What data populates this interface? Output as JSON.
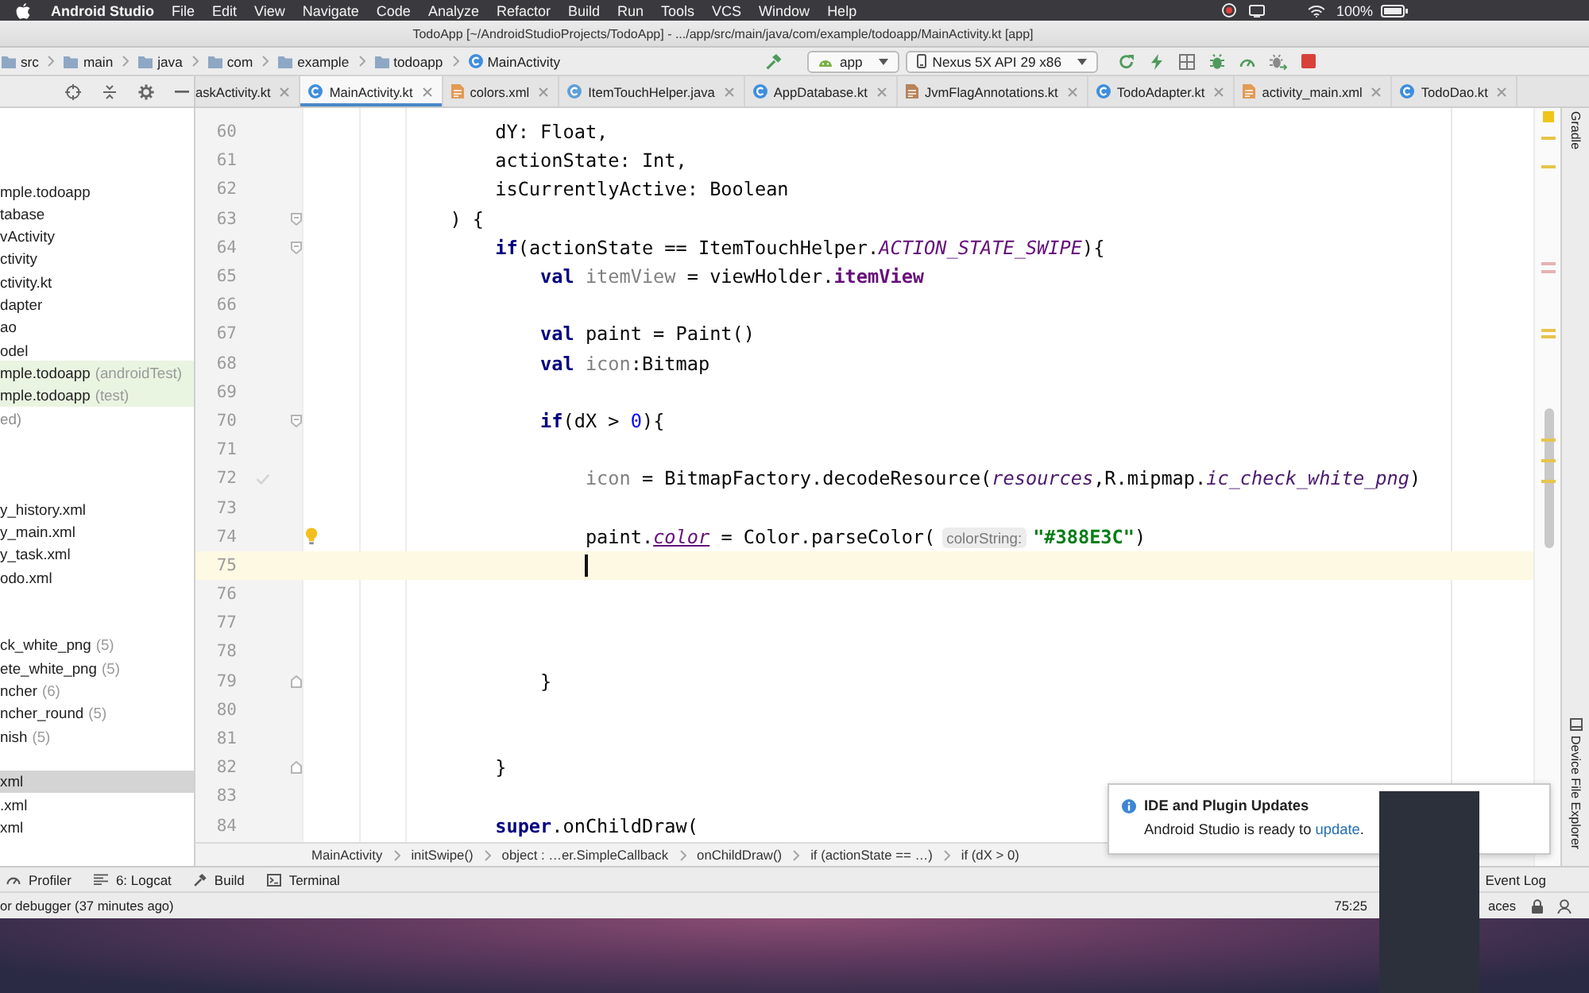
{
  "menu_bar": {
    "app_name": "Android Studio",
    "items": [
      "File",
      "Edit",
      "View",
      "Navigate",
      "Code",
      "Analyze",
      "Refactor",
      "Build",
      "Run",
      "Tools",
      "VCS",
      "Window",
      "Help"
    ],
    "battery": "100%"
  },
  "window": {
    "title": "TodoApp [~/AndroidStudioProjects/TodoApp] - .../app/src/main/java/com/example/todoapp/MainActivity.kt [app]"
  },
  "navigation_bar": {
    "path": [
      {
        "label": "src",
        "kind": "folder"
      },
      {
        "label": "main",
        "kind": "folder"
      },
      {
        "label": "java",
        "kind": "folder"
      },
      {
        "label": "com",
        "kind": "folder"
      },
      {
        "label": "example",
        "kind": "folder"
      },
      {
        "label": "todoapp",
        "kind": "folder"
      },
      {
        "label": "MainActivity",
        "kind": "class"
      }
    ],
    "run_config": "app",
    "device": "Nexus 5X API 29 x86"
  },
  "editor_tabs": [
    {
      "label": "askActivity.kt",
      "kind": "clipped",
      "selected": false
    },
    {
      "label": "MainActivity.kt",
      "kind": "kotlin-class",
      "selected": true
    },
    {
      "label": "colors.xml",
      "kind": "xml",
      "selected": false
    },
    {
      "label": "ItemTouchHelper.java",
      "kind": "java-class",
      "selected": false
    },
    {
      "label": "AppDatabase.kt",
      "kind": "kotlin-class",
      "selected": false
    },
    {
      "label": "JvmFlagAnnotations.kt",
      "kind": "kotlin-file",
      "selected": false
    },
    {
      "label": "TodoAdapter.kt",
      "kind": "kotlin-class",
      "selected": false
    },
    {
      "label": "activity_main.xml",
      "kind": "xml",
      "selected": false
    },
    {
      "label": "TodoDao.kt",
      "kind": "kotlin-class",
      "selected": false
    }
  ],
  "project_tree": [
    {
      "kind": "cut-off",
      "selected": false
    },
    {
      "kind": "cut-off",
      "selected": false
    },
    {
      "kind": "cut-off",
      "selected": false
    },
    {
      "label": "mple.todoapp",
      "kind": "node",
      "selected": false
    },
    {
      "label": "tabase",
      "kind": "node",
      "selected": false
    },
    {
      "label": "vActivity",
      "kind": "node",
      "selected": false
    },
    {
      "label": "ctivity",
      "kind": "node",
      "selected": false
    },
    {
      "label": "ctivity.kt",
      "kind": "node",
      "selected": false
    },
    {
      "label": "dapter",
      "kind": "node",
      "selected": false
    },
    {
      "label": "ao",
      "kind": "node",
      "selected": false
    },
    {
      "label": "odel",
      "kind": "node",
      "selected": false
    },
    {
      "label": "mple.todoapp",
      "hint": "(androidTest)",
      "kind": "test-root",
      "selected": false
    },
    {
      "label": "mple.todoapp",
      "hint": "(test)",
      "kind": "test-root",
      "selected": false
    },
    {
      "label": "ed)",
      "kind": "generated",
      "selected": false
    },
    {
      "kind": "cut-off",
      "selected": false
    },
    {
      "kind": "cut-off",
      "selected": false
    },
    {
      "kind": "cut-off",
      "selected": false
    },
    {
      "label": "y_history.xml",
      "kind": "node",
      "selected": false
    },
    {
      "label": "y_main.xml",
      "kind": "node",
      "selected": false
    },
    {
      "label": "y_task.xml",
      "kind": "node",
      "selected": false
    },
    {
      "label": "odo.xml",
      "kind": "node",
      "selected": false
    },
    {
      "kind": "cut-off",
      "selected": false
    },
    {
      "kind": "cut-off",
      "selected": false
    },
    {
      "label": "ck_white_png",
      "hint": "(5)",
      "kind": "node",
      "selected": false
    },
    {
      "label": "ete_white_png",
      "hint": "(5)",
      "kind": "node",
      "selected": false
    },
    {
      "label": "ncher",
      "hint": "(6)",
      "kind": "node",
      "selected": false
    },
    {
      "label": "ncher_round",
      "hint": "(5)",
      "kind": "node",
      "selected": false
    },
    {
      "label": "nish",
      "hint": "(5)",
      "kind": "node",
      "selected": false
    },
    {
      "kind": "cut-off",
      "selected": false
    },
    {
      "label": "xml",
      "kind": "node",
      "selected": true
    },
    {
      "label": ".xml",
      "kind": "node",
      "selected": false
    },
    {
      "label": "xml",
      "kind": "node",
      "selected": false
    }
  ],
  "editor": {
    "lines": [
      {
        "number": "60",
        "kind": "plain",
        "current": false,
        "tokens": [
          {
            "text": "                dY: Float,",
            "kind": "plain"
          }
        ]
      },
      {
        "number": "61",
        "kind": "plain",
        "current": false,
        "tokens": [
          {
            "text": "                actionState: Int,",
            "kind": "plain"
          }
        ]
      },
      {
        "number": "62",
        "kind": "plain",
        "current": false,
        "tokens": [
          {
            "text": "                isCurrentlyActive: Boolean",
            "kind": "plain"
          }
        ]
      },
      {
        "number": "63",
        "kind": "fold-start",
        "current": false,
        "tokens": [
          {
            "text": "            ) {",
            "kind": "plain"
          }
        ]
      },
      {
        "number": "64",
        "kind": "fold-start",
        "current": false,
        "tokens": [
          {
            "text": "                if",
            "kind": "keyword"
          },
          {
            "text": "(actionState == ItemTouchHelper.",
            "kind": "plain"
          },
          {
            "text": "ACTION_STATE_SWIPE",
            "kind": "constant"
          },
          {
            "text": "){",
            "kind": "plain"
          }
        ]
      },
      {
        "number": "65",
        "kind": "plain",
        "current": false,
        "tokens": [
          {
            "text": "                    val",
            "kind": "keyword"
          },
          {
            "text": " itemView",
            "kind": "unused"
          },
          {
            "text": " = viewHolder.",
            "kind": "plain"
          },
          {
            "text": "itemView",
            "kind": "field"
          }
        ]
      },
      {
        "number": "66",
        "kind": "plain",
        "current": false
      },
      {
        "number": "67",
        "kind": "plain",
        "current": false,
        "tokens": [
          {
            "text": "                    val",
            "kind": "keyword"
          },
          {
            "text": " paint = Paint()",
            "kind": "plain"
          }
        ]
      },
      {
        "number": "68",
        "kind": "plain",
        "current": false,
        "tokens": [
          {
            "text": "                    val",
            "kind": "keyword"
          },
          {
            "text": " icon",
            "kind": "unused"
          },
          {
            "text": ":Bitmap",
            "kind": "plain"
          }
        ]
      },
      {
        "number": "69",
        "kind": "plain",
        "current": false
      },
      {
        "number": "70",
        "kind": "fold-start",
        "current": false,
        "tokens": [
          {
            "text": "                    if",
            "kind": "keyword"
          },
          {
            "text": "(dX > ",
            "kind": "plain"
          },
          {
            "text": "0",
            "kind": "number"
          },
          {
            "text": "){",
            "kind": "plain"
          }
        ]
      },
      {
        "number": "71",
        "kind": "plain",
        "current": false
      },
      {
        "number": "72",
        "kind": "check",
        "current": false,
        "tokens": [
          {
            "text": "                        icon",
            "kind": "unused"
          },
          {
            "text": " = BitmapFactory.decodeResource(",
            "kind": "plain"
          },
          {
            "text": "resources",
            "kind": "italic"
          },
          {
            "text": ",R.mipmap.",
            "kind": "plain"
          },
          {
            "text": "ic_check_white_png",
            "kind": "italic"
          },
          {
            "text": ")",
            "kind": "plain"
          }
        ]
      },
      {
        "number": "73",
        "kind": "plain",
        "current": false
      },
      {
        "number": "74",
        "kind": "bulb",
        "current": false,
        "tokens": [
          {
            "text": "                        paint.",
            "kind": "plain"
          },
          {
            "text": "color",
            "kind": "synthetic"
          },
          {
            "text": " = Color.parseColor(",
            "kind": "plain"
          },
          {
            "text": "colorString:",
            "kind": "hint"
          },
          {
            "text": "\"#388E3C\"",
            "kind": "string"
          },
          {
            "text": ")",
            "kind": "plain"
          }
        ]
      },
      {
        "number": "75",
        "kind": "plain",
        "current": true
      },
      {
        "number": "76",
        "kind": "plain",
        "current": false
      },
      {
        "number": "77",
        "kind": "plain",
        "current": false
      },
      {
        "number": "78",
        "kind": "plain",
        "current": false
      },
      {
        "number": "79",
        "kind": "fold-end",
        "current": false,
        "tokens": [
          {
            "text": "                    }",
            "kind": "plain"
          }
        ]
      },
      {
        "number": "80",
        "kind": "plain",
        "current": false
      },
      {
        "number": "81",
        "kind": "plain",
        "current": false
      },
      {
        "number": "82",
        "kind": "fold-end",
        "current": false,
        "tokens": [
          {
            "text": "                }",
            "kind": "plain"
          }
        ]
      },
      {
        "number": "83",
        "kind": "plain",
        "current": false
      },
      {
        "number": "84",
        "kind": "plain",
        "current": false,
        "tokens": [
          {
            "text": "                super",
            "kind": "keyword"
          },
          {
            "text": ".onChildDraw(",
            "kind": "plain"
          }
        ]
      }
    ],
    "breadcrumbs": [
      "MainActivity",
      "initSwipe()",
      "object : …er.SimpleCallback",
      "onChildDraw()",
      "if (actionState == …)",
      "if (dX > 0)"
    ]
  },
  "notification": {
    "title": "IDE and Plugin Updates",
    "text": "Android Studio is ready to",
    "link": "update",
    "text_end": "."
  },
  "tool_strip": {
    "top": "Gradle",
    "bottom": "Device File Explorer"
  },
  "tool_buttons": [
    {
      "label": "Profiler",
      "kind": "profiler"
    },
    {
      "label": "6: Logcat",
      "kind": "logcat"
    },
    {
      "label": "Build",
      "kind": "build"
    },
    {
      "label": "Terminal",
      "kind": "terminal"
    }
  ],
  "event_log": "Event Log",
  "status_bar": {
    "message": "or debugger (37 minutes ago)",
    "position": "75:25",
    "indent": "aces"
  }
}
